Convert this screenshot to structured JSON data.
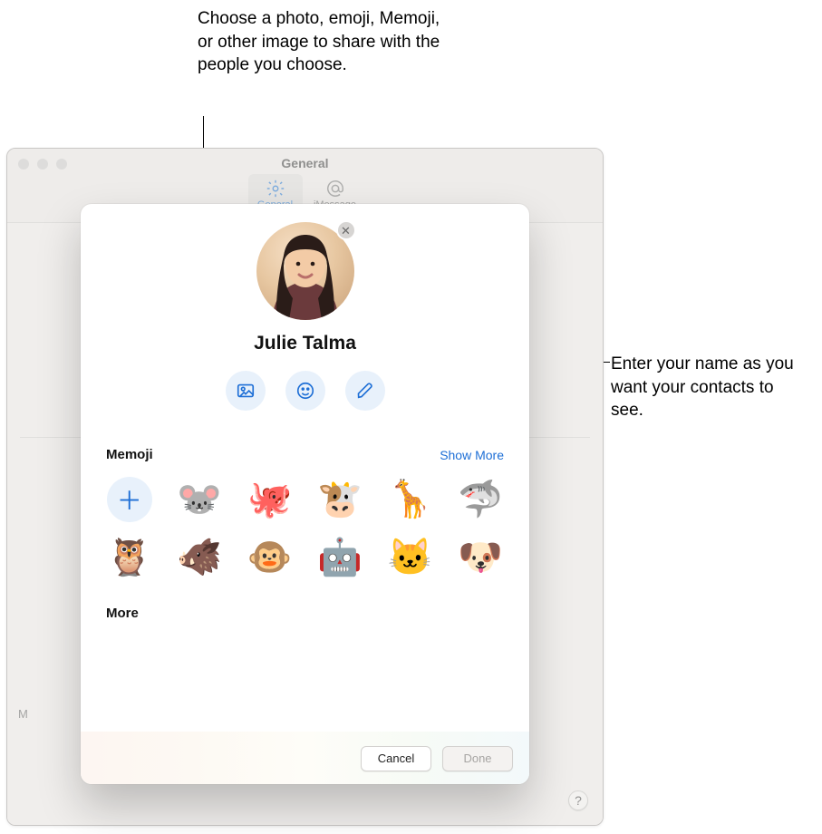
{
  "callouts": {
    "top": "Choose a photo, emoji, Memoji, or other image to share with the people you choose.",
    "right": "Enter your name as you want your contacts to see."
  },
  "prefs": {
    "window_title": "General",
    "tabs": [
      "General",
      "iMessage"
    ],
    "faint_label": "M",
    "help_glyph": "?"
  },
  "sheet": {
    "display_name": "Julie Talma",
    "avatar_close_glyph": "✕",
    "icon_buttons": {
      "photo": "photo-icon",
      "emoji": "smiley-icon",
      "edit": "pencil-icon"
    },
    "memoji": {
      "title": "Memoji",
      "show_more": "Show More",
      "add_glyph": "＋",
      "items": [
        "🐭",
        "🐙",
        "🐮",
        "🦒",
        "🦈",
        "🦉",
        "🐗",
        "🐵",
        "🤖",
        "🐱",
        "🐶"
      ]
    },
    "more": {
      "title": "More"
    },
    "footer": {
      "cancel": "Cancel",
      "done": "Done"
    }
  }
}
